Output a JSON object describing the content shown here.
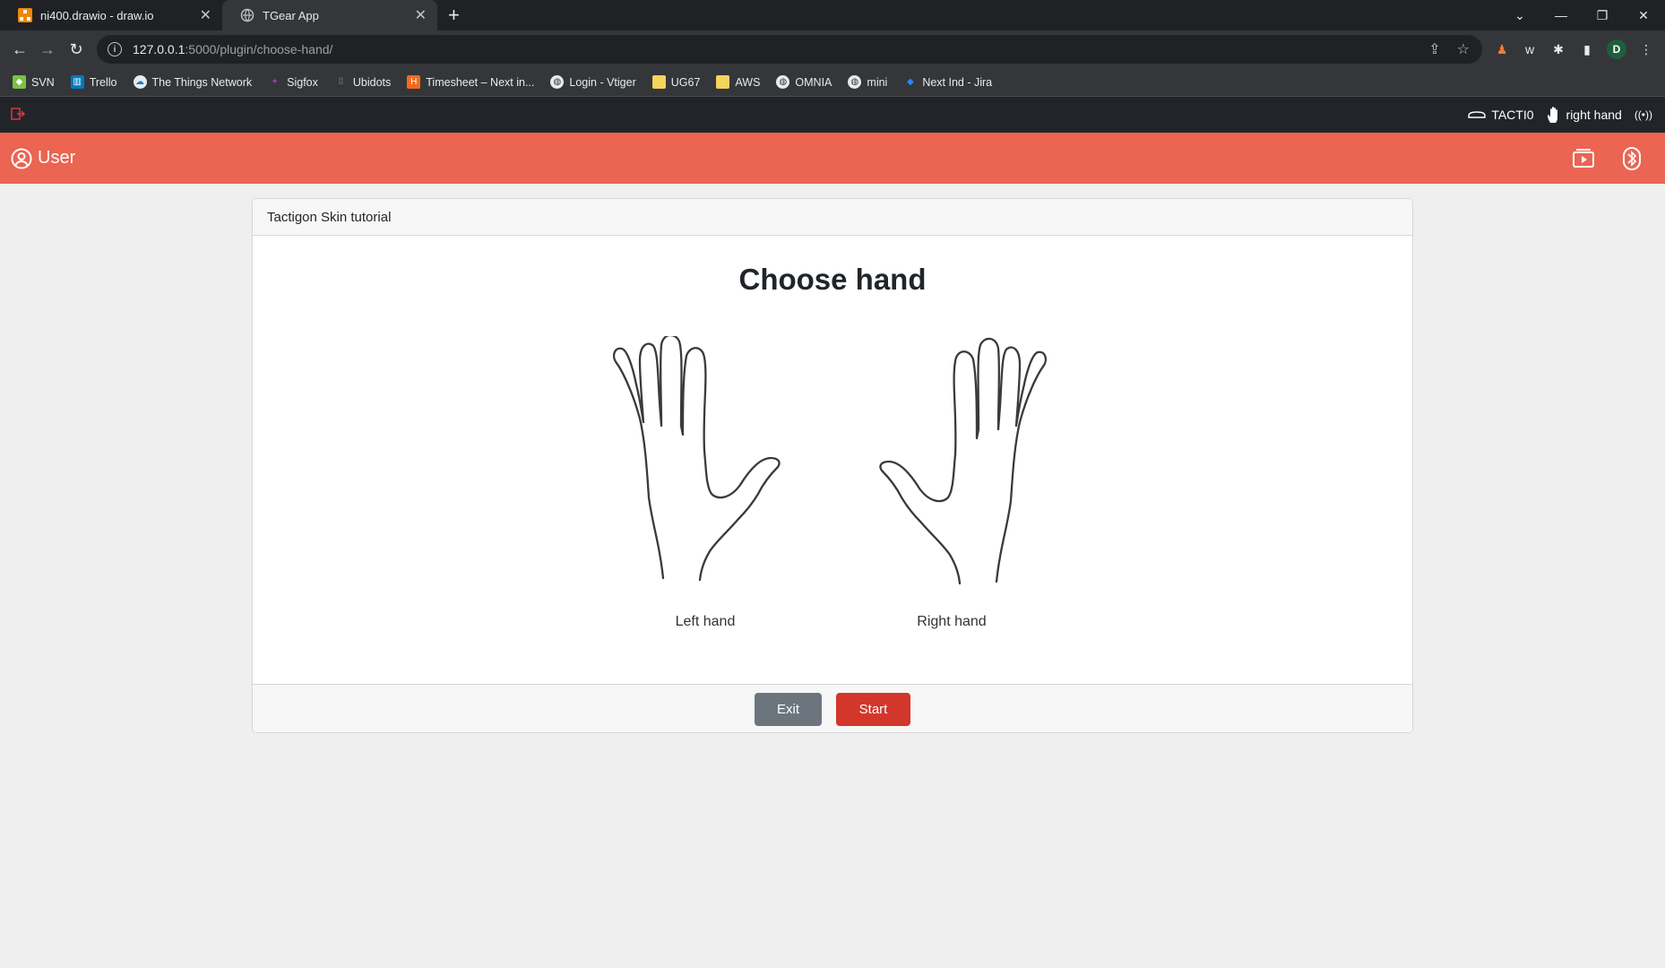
{
  "browser": {
    "tabs": [
      {
        "title": "ni400.drawio - draw.io",
        "active": false
      },
      {
        "title": "TGear App",
        "active": true
      }
    ],
    "url_host": "127.0.0.1",
    "url_rest": ":5000/plugin/choose-hand/",
    "bookmarks": [
      {
        "label": "SVN",
        "icon": "svn-icon"
      },
      {
        "label": "Trello",
        "icon": "trello-icon"
      },
      {
        "label": "The Things Network",
        "icon": "ttn-icon"
      },
      {
        "label": "Sigfox",
        "icon": "sigfox-icon"
      },
      {
        "label": "Ubidots",
        "icon": "ubidots-icon"
      },
      {
        "label": "Timesheet – Next in...",
        "icon": "timesheet-icon"
      },
      {
        "label": "Login - Vtiger",
        "icon": "globe-icon"
      },
      {
        "label": "UG67",
        "icon": "folder-icon"
      },
      {
        "label": "AWS",
        "icon": "folder-icon"
      },
      {
        "label": "OMNIA",
        "icon": "globe-icon"
      },
      {
        "label": "mini",
        "icon": "globe-icon"
      },
      {
        "label": "Next Ind - Jira",
        "icon": "jira-icon"
      }
    ],
    "profile_initial": "D"
  },
  "appbar": {
    "device": "TACTI0",
    "hand": "right hand"
  },
  "header": {
    "user_label": "User"
  },
  "card": {
    "header": "Tactigon Skin tutorial",
    "title": "Choose hand",
    "left_label": "Left hand",
    "right_label": "Right hand",
    "exit_label": "Exit",
    "start_label": "Start"
  },
  "colors": {
    "accent": "#ec6452",
    "start_button": "#d3372b",
    "exit_button": "#6c757d",
    "appbar": "#212529"
  }
}
